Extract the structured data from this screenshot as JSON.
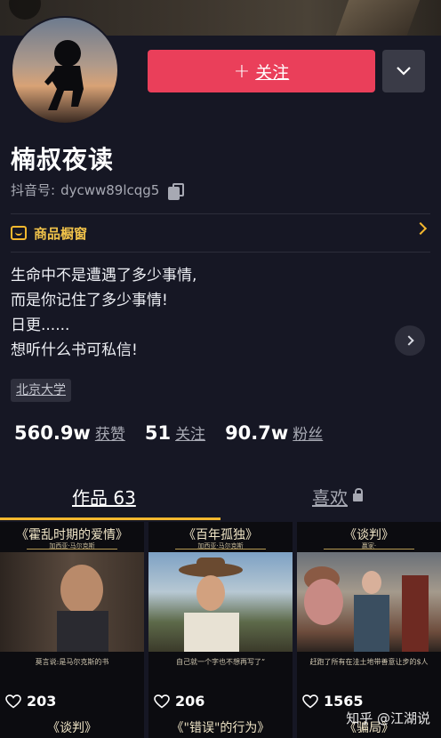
{
  "profile": {
    "name": "楠叔夜读",
    "douyin_id_label": "抖音号:",
    "douyin_id": "dycww89lcqg5",
    "follow_label": "关注",
    "follow_plus": "+"
  },
  "shop": {
    "label": "商品橱窗"
  },
  "bio": {
    "lines": [
      "生命中不是遭遇了多少事情,",
      "而是你记住了多少事情!",
      "日更......",
      "想听什么书可私信!"
    ]
  },
  "tag": "北京大学",
  "stats": [
    {
      "value": "560.9w",
      "label": "获赞"
    },
    {
      "value": "51",
      "label": "关注"
    },
    {
      "value": "90.7w",
      "label": "粉丝"
    }
  ],
  "tabs": {
    "works_label": "作品 63",
    "likes_label": "喜欢"
  },
  "videos": [
    {
      "title": "《霍乱时期的爱情》",
      "subtitle": "加西亚·马尔克斯",
      "caption": "莫言说:是马尔克斯的书",
      "likes": "203"
    },
    {
      "title": "《百年孤独》",
      "subtitle": "加西亚·马尔克斯",
      "caption": "自己就一个字也不想再写了”",
      "likes": "206"
    },
    {
      "title": "《谈判》",
      "subtitle": "赢家·",
      "caption": "赶跑了所有在洼土地带善意让步的$人",
      "likes": "1565"
    }
  ],
  "videos_row2": [
    "《谈判》",
    "《\"错误\"的行为》",
    "《骗局》"
  ],
  "watermark": "知乎 @江湖说",
  "colors": {
    "accent": "#ea3f5a",
    "shop": "#f5b82e",
    "background": "#161724"
  }
}
